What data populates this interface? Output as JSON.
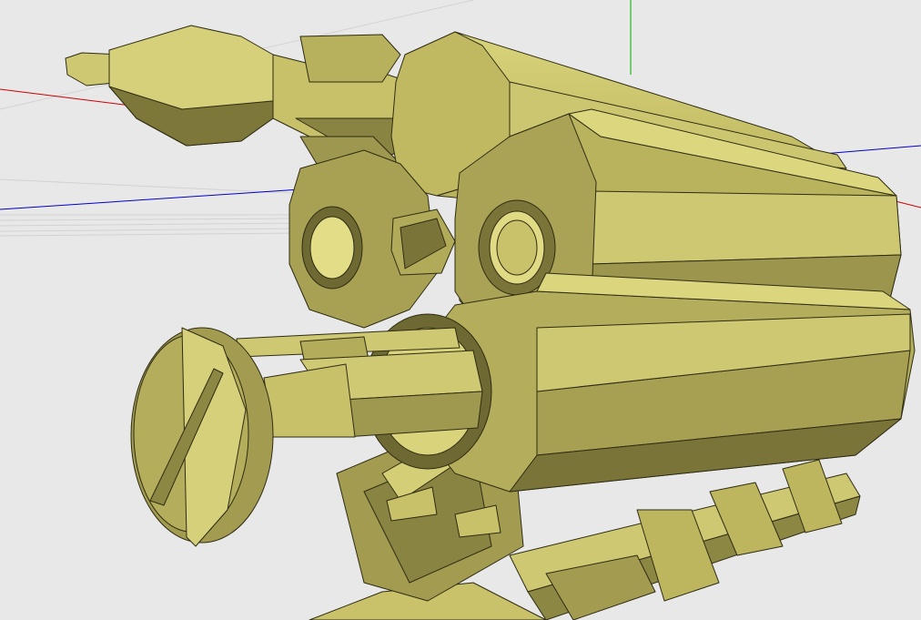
{
  "viewport": {
    "background": "#e8e8e8",
    "axes": {
      "x_color": "#cc0000",
      "y_color": "#00aa00",
      "z_color": "#0000cc"
    },
    "model": {
      "color_light": "#d8d27a",
      "color_mid": "#b5ae5a",
      "color_dark": "#6b6530",
      "edge_color": "#2e2c14"
    }
  }
}
